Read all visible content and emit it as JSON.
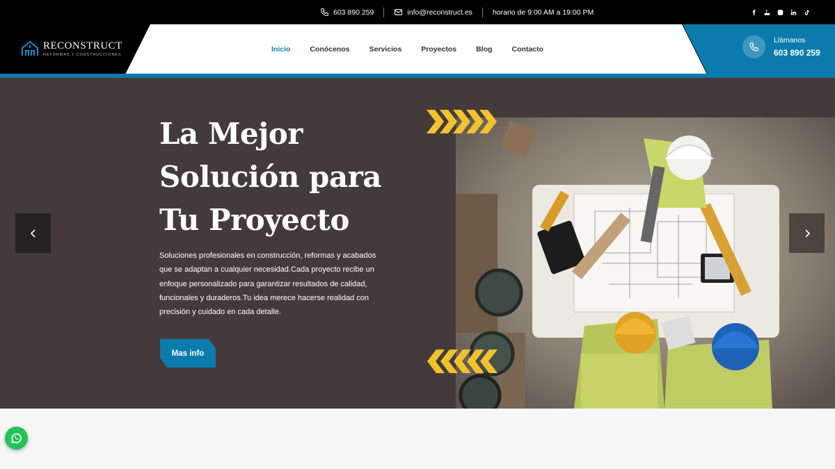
{
  "topbar": {
    "phone": "603 890 259",
    "email": "info@reconstruct.es",
    "hours": "horario de 9:00 AM a 19:00 PM",
    "social": [
      "facebook-icon",
      "youtube-icon",
      "instagram-icon",
      "linkedin-icon",
      "tiktok-icon"
    ]
  },
  "logo": {
    "name": "RECONSTRUCT",
    "tagline": "REFORMAS Y CONSTRUCCIONES"
  },
  "nav": {
    "items": [
      "Inicio",
      "Conócenos",
      "Servicios",
      "Proyectos",
      "Blog",
      "Contacto"
    ],
    "active": "Inicio"
  },
  "call": {
    "label": "Llámanos",
    "number": "603 890 259"
  },
  "hero": {
    "title": "La Mejor Solución para Tu Proyecto",
    "text": "Soluciones profesionales en construcción, reformas y acabados que se adaptan a cualquier necesidad.Cada proyecto recibe un enfoque personalizado para garantizar resultados de calidad, funcionales y duraderos.Tu idea merece hacerse realidad con precisión y cuidado en cada detalle.",
    "button": "Mas info"
  },
  "colors": {
    "accent": "#0b7bad",
    "hero_bg": "#453a3b",
    "chevrons": "#f2c12e",
    "whatsapp": "#25c15a"
  }
}
